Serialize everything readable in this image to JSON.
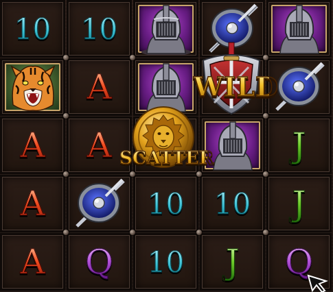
{
  "reels": {
    "rows": [
      [
        "10",
        "10",
        "gladiator-helmet",
        "shield",
        "gladiator-helmet"
      ],
      [
        "tiger",
        "A",
        "gladiator-helmet",
        "wild",
        "shield"
      ],
      [
        "A",
        "A",
        "scatter",
        "gladiator-helmet",
        "J"
      ],
      [
        "A",
        "shield",
        "10",
        "10",
        "J"
      ],
      [
        "A",
        "Q",
        "10",
        "J",
        "Q"
      ]
    ]
  },
  "labels": {
    "wild": "WILD",
    "scatter": "SCATTER",
    "ten": "10",
    "a": "A",
    "j": "J",
    "q": "Q"
  },
  "icons": {
    "helmet": "gladiator-helmet-icon",
    "shield": "shield-icon",
    "tiger": "tiger-icon",
    "lion": "lion-medallion-icon",
    "wild_emblem": "sword-shield-emblem-icon",
    "cursor": "pointer-icon"
  },
  "colors": {
    "ten": "#3cc3d6",
    "a": "#f04a1e",
    "j": "#6ecc2a",
    "q": "#b04fd6",
    "gold": "#f3c02a",
    "frame": "#0f0a08"
  }
}
